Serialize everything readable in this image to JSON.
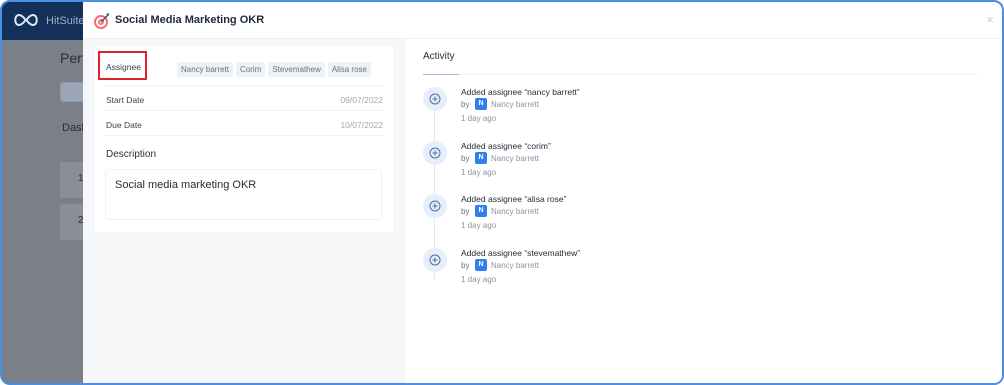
{
  "background": {
    "brand_text": "HitSuite",
    "page_title_partial": "Perf",
    "tab_partial": "Dash",
    "card_numbers": [
      "1",
      "2"
    ]
  },
  "modal": {
    "title": "Social Media Marketing OKR",
    "close_glyph": "×"
  },
  "details": {
    "assignee_label": "Assignee",
    "assignees": [
      "Nancy barrett",
      "Corim",
      "Stevemathew",
      "Alisa rose"
    ],
    "start_date_label": "Start Date",
    "start_date_value": "09/07/2022",
    "due_date_label": "Due Date",
    "due_date_value": "10/07/2022",
    "description_label": "Description",
    "description_text": "Social media marketing OKR"
  },
  "activity": {
    "title": "Activity",
    "items": [
      {
        "action": "Added",
        "text": "assignee “nancy barrett”",
        "by": "by",
        "avatar": "N",
        "user": "Nancy barrett",
        "time": "1 day ago"
      },
      {
        "action": "Added",
        "text": "assignee “corim”",
        "by": "by",
        "avatar": "N",
        "user": "Nancy barrett",
        "time": "1 day ago"
      },
      {
        "action": "Added",
        "text": "assignee “alisa rose”",
        "by": "by",
        "avatar": "N",
        "user": "Nancy barrett",
        "time": "1 day ago"
      },
      {
        "action": "Added",
        "text": "assignee “stevemathew”",
        "by": "by",
        "avatar": "N",
        "user": "Nancy barrett",
        "time": "1 day ago"
      }
    ]
  },
  "colors": {
    "accent": "#2f80ed",
    "highlight_border": "#e0242a",
    "header_bg": "#12305a"
  }
}
